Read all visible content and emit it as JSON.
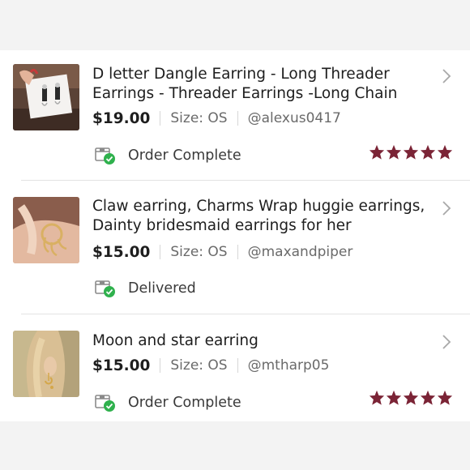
{
  "orders": [
    {
      "title": "D letter Dangle Earring - Long Threader Earrings - Threader Earrings -Long Chain",
      "price": "$19.00",
      "size": "Size: OS",
      "seller": "@alexus0417",
      "status": "Order Complete",
      "rating": 5,
      "thumbnail": "earring-card-thumbnail"
    },
    {
      "title": "Claw earring,  Charms Wrap huggie earrings, Dainty bridesmaid earrings for her",
      "price": "$15.00",
      "size": "Size: OS",
      "seller": "@maxandpiper",
      "status": "Delivered",
      "rating": null,
      "thumbnail": "claw-earring-thumbnail"
    },
    {
      "title": "Moon and star earring",
      "price": "$15.00",
      "size": "Size: OS",
      "seller": "@mtharp05",
      "status": "Order Complete",
      "rating": 5,
      "thumbnail": "moon-star-earring-thumbnail"
    }
  ],
  "colors": {
    "star": "#7b2436",
    "check_badge": "#2fb14d",
    "background": "#f3f3f3",
    "card": "#ffffff"
  },
  "icons": {
    "status": "package-check-icon",
    "chevron": "chevron-right-icon",
    "rating": "star-icon"
  }
}
